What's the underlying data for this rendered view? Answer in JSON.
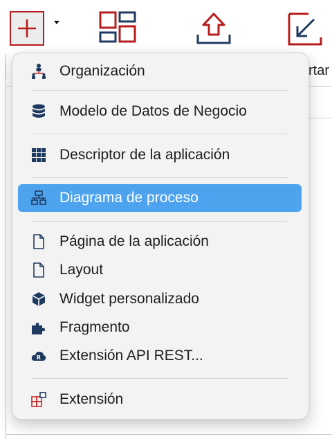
{
  "toolbar": {
    "add_icon": "plus-icon",
    "dropdown_icon": "triangle-down-icon",
    "overview_icon": "overview-grid-icon",
    "export_icon": "export-upload-icon",
    "import_icon": "import-arrow-icon",
    "partial_label": "rtar",
    "colors": {
      "brand_red": "#b71c1c",
      "button_bg": "#ececec"
    }
  },
  "menu": {
    "highlight_color": "#4da3ee",
    "items": [
      {
        "label": "Organización",
        "icon": "organization-icon"
      },
      {
        "label": "Modelo de Datos de Negocio",
        "icon": "database-icon"
      },
      {
        "label": "Descriptor de la aplicación",
        "icon": "grid-icon"
      },
      {
        "label": "Diagrama de proceso",
        "icon": "process-diagram-icon",
        "highlighted": true
      },
      {
        "label": "Página de la aplicación",
        "icon": "page-icon"
      },
      {
        "label": "Layout",
        "icon": "layout-page-icon"
      },
      {
        "label": "Widget personalizado",
        "icon": "cube-icon"
      },
      {
        "label": "Fragmento",
        "icon": "puzzle-icon"
      },
      {
        "label": "Extensión API REST...",
        "icon": "cloud-rest-icon"
      },
      {
        "label": "Extensión",
        "icon": "extension-icon"
      }
    ]
  }
}
